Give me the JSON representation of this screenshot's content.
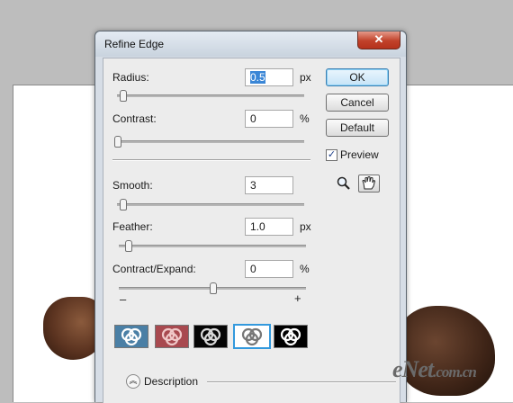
{
  "dialog": {
    "title": "Refine Edge",
    "close_glyph": "✕"
  },
  "params": {
    "radius": {
      "label": "Radius:",
      "value": "0.5",
      "unit": "px",
      "slider_fraction": 0.03
    },
    "contrast": {
      "label": "Contrast:",
      "value": "0",
      "unit": "%",
      "slider_fraction": 0.0
    },
    "smooth": {
      "label": "Smooth:",
      "value": "3",
      "slider_fraction": 0.03
    },
    "feather": {
      "label": "Feather:",
      "value": "1.0",
      "unit": "px",
      "slider_fraction": 0.05
    },
    "contract_expand": {
      "label": "Contract/Expand:",
      "value": "0",
      "unit": "%",
      "slider_fraction": 0.5,
      "minus": "–",
      "plus": "+"
    }
  },
  "buttons": {
    "ok": "OK",
    "cancel": "Cancel",
    "default": "Default"
  },
  "preview": {
    "label": "Preview",
    "checked": true,
    "check_glyph": "✓"
  },
  "tools": [
    "zoom-tool",
    "hand-tool"
  ],
  "preview_modes": [
    {
      "name": "standard",
      "bg": "#4a7fa5",
      "ring": "#ffffff"
    },
    {
      "name": "quick-mask",
      "bg": "#a8494f",
      "ring": "#f0c8c8"
    },
    {
      "name": "on-black",
      "bg": "#050505",
      "ring": "#d8d8d8"
    },
    {
      "name": "on-white",
      "bg": "#ffffff",
      "ring": "#777777",
      "selected": true
    },
    {
      "name": "mask",
      "bg": "#000000",
      "ring": "#ffffff"
    }
  ],
  "description": {
    "label": "Description"
  },
  "watermark": {
    "text": "eNet",
    "suffix": ".com.cn"
  }
}
